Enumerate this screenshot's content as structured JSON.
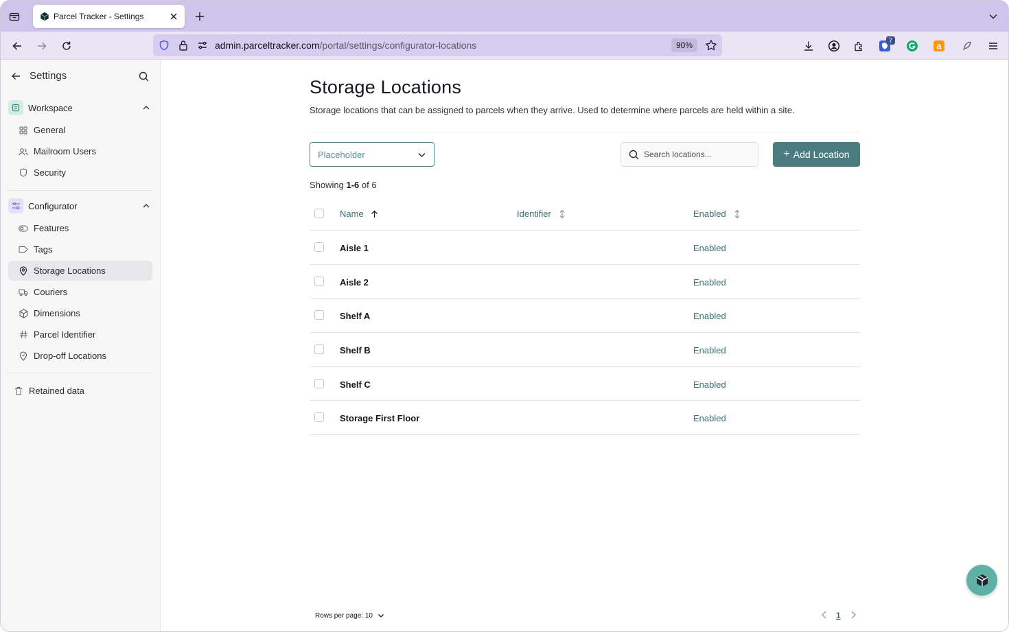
{
  "browser": {
    "tab_title": "Parcel Tracker - Settings",
    "url_host": "admin.parceltracker.com",
    "url_path": "/portal/settings/configurator-locations",
    "zoom": "90%",
    "extension_badge": "7"
  },
  "sidebar": {
    "title": "Settings",
    "workspace": {
      "label": "Workspace",
      "items": [
        {
          "label": "General",
          "icon": "grid-icon"
        },
        {
          "label": "Mailroom Users",
          "icon": "users-icon"
        },
        {
          "label": "Security",
          "icon": "shield-icon"
        }
      ]
    },
    "configurator": {
      "label": "Configurator",
      "items": [
        {
          "label": "Features",
          "icon": "toggle-icon"
        },
        {
          "label": "Tags",
          "icon": "tag-icon"
        },
        {
          "label": "Storage Locations",
          "icon": "location-pin-icon",
          "active": true
        },
        {
          "label": "Couriers",
          "icon": "truck-icon"
        },
        {
          "label": "Dimensions",
          "icon": "box-icon"
        },
        {
          "label": "Parcel Identifier",
          "icon": "hash-icon"
        },
        {
          "label": "Drop-off Locations",
          "icon": "location-pin-icon"
        }
      ]
    },
    "retained_data": "Retained data"
  },
  "main": {
    "title": "Storage Locations",
    "description": "Storage locations that can be assigned to parcels when they arrive. Used to determine where parcels are held within a site.",
    "select_value": "Placeholder",
    "search_placeholder": "Search locations...",
    "add_button": "Add Location",
    "showing_prefix": "Showing",
    "showing_range": "1-6",
    "showing_suffix": "of 6",
    "columns": [
      "Name",
      "Identifier",
      "Enabled"
    ],
    "rows": [
      {
        "name": "Aisle 1",
        "identifier": "",
        "enabled": "Enabled"
      },
      {
        "name": "Aisle 2",
        "identifier": "",
        "enabled": "Enabled"
      },
      {
        "name": "Shelf A",
        "identifier": "",
        "enabled": "Enabled"
      },
      {
        "name": "Shelf B",
        "identifier": "",
        "enabled": "Enabled"
      },
      {
        "name": "Shelf C",
        "identifier": "",
        "enabled": "Enabled"
      },
      {
        "name": "Storage First Floor",
        "identifier": "",
        "enabled": "Enabled"
      }
    ],
    "rows_per_page": "Rows per page: 10",
    "current_page": "1"
  },
  "colors": {
    "accent": "#4b7c80",
    "link_teal": "#3f6f76",
    "tab_strip": "#cfc4ec",
    "fab": "#5fb0a6"
  }
}
